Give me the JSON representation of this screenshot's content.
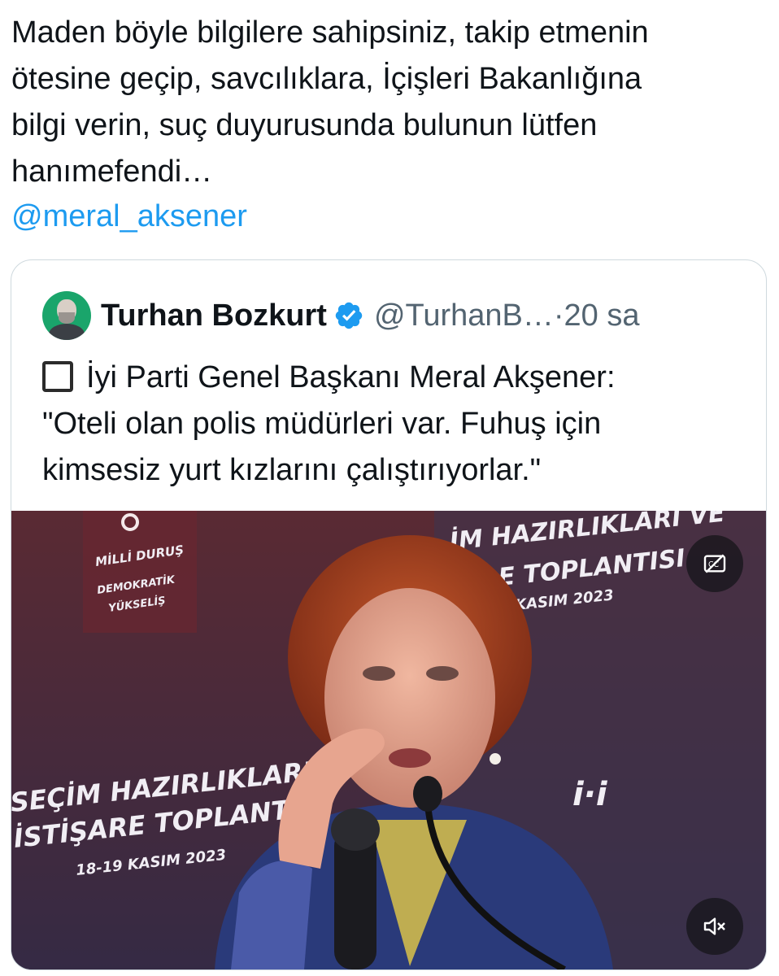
{
  "tweet": {
    "text": "Maden böyle bilgilere sahipsiniz, takip etmenin\nötesine geçip, savcılıklara, İçişleri Bakanlığına\nbilgi verin, suç duyurusunda bulunun lütfen\nhanımefendi…",
    "mention": "@meral_aksener"
  },
  "quote": {
    "author_name": "Turhan Bozkurt",
    "handle": "@TurhanB…",
    "separator": " · ",
    "time": "20 sa",
    "text": "İyi Parti Genel Başkanı Meral Akşener:\n\"Oteli olan polis müdürleri var. Fuhuş için\nkimsesiz yurt kızlarını çalıştırıyorlar.\"",
    "emoji": "black-square-button"
  },
  "video": {
    "banner_left": [
      "MİLLİ DURUŞ",
      "DEMOKRATİK",
      "YÜKSELİŞ"
    ],
    "banner_top_right": [
      "İM HAZIRLIKLARI VE",
      "E TOPLANTISI",
      "KASIM 2023"
    ],
    "banner_bottom_left": [
      "SEÇİM HAZIRLIKLARI VE",
      "İSTİŞARE TOPLANTISI",
      "18-19 KASIM 2023"
    ],
    "captions_icon": "captions-off-icon",
    "mute_icon": "volume-muted-icon"
  },
  "colors": {
    "text": "#0f1419",
    "secondary": "#536471",
    "link": "#1d9bf0",
    "verified": "#1d9bf0",
    "border": "#cfd9de"
  }
}
